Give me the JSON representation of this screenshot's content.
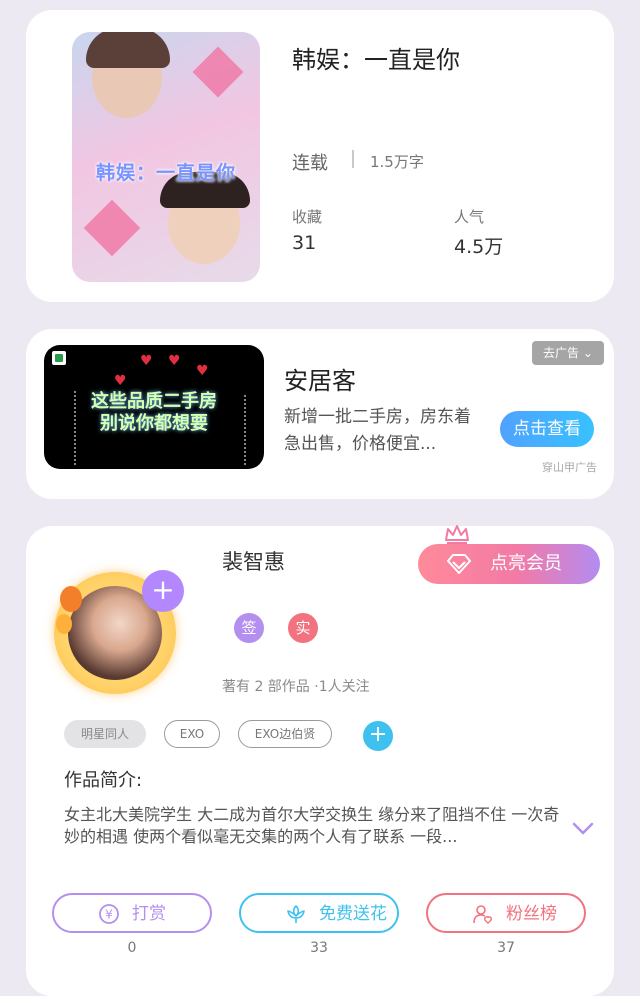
{
  "book": {
    "cover_title": "韩娱：一直是你",
    "title": "韩娱：一直是你",
    "status": "连载",
    "word_count": "1.5万字",
    "stats": [
      {
        "label": "收藏",
        "value": "31"
      },
      {
        "label": "人气",
        "value": "4.5万"
      }
    ]
  },
  "ad": {
    "image_lines": [
      "这些品质二手房",
      "别说你都想要"
    ],
    "name": "安居客",
    "description": "新增一批二手房，房东着急出售，价格便宜...",
    "close_label": "去广告",
    "cta_label": "点击查看",
    "source_label": "穿山甲广告"
  },
  "author": {
    "name": "裴智惠",
    "follow_symbol": "+",
    "vip_label": "点亮会员",
    "badges": [
      {
        "label": "签",
        "color": "#b48ff0"
      },
      {
        "label": "实",
        "color": "#f2727f"
      }
    ],
    "works_meta": "著有 2 部作品 ·1人关注",
    "tags": [
      "明星同人",
      "EXO",
      "EXO边伯贤"
    ],
    "tag_add_symbol": "+"
  },
  "intro": {
    "title": "作品简介:",
    "text": "女主北大美院学生 大二成为首尔大学交换生  缘分来了阻挡不住 一次奇妙的相遇 使两个看似毫无交集的两个人有了联系  一段..."
  },
  "actions": [
    {
      "label": "打赏",
      "count": "0",
      "color": "#b48ff0",
      "icon": "yen-icon"
    },
    {
      "label": "免费送花",
      "count": "33",
      "color": "#3fc1ef",
      "icon": "flower-icon"
    },
    {
      "label": "粉丝榜",
      "count": "37",
      "color": "#f2727f",
      "icon": "fan-icon"
    }
  ],
  "colors": {
    "background": "#ece9f2",
    "card": "#ffffff",
    "cta_blue": "#3fa7ff",
    "vip_gradient_start": "#ff8a9a",
    "vip_gradient_end": "#b38cf2"
  }
}
